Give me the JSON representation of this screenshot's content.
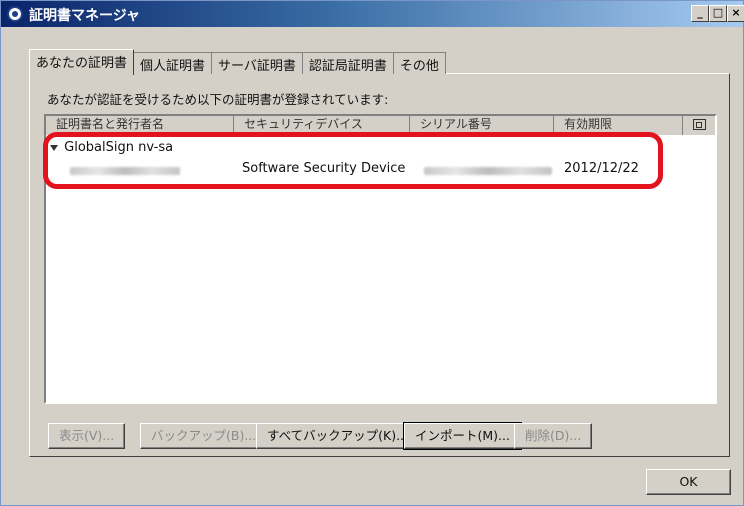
{
  "window": {
    "title": "証明書マネージャ",
    "controls": {
      "minimize": "_",
      "maximize": "□",
      "close": "×"
    }
  },
  "tabs": [
    {
      "label": "あなたの証明書"
    },
    {
      "label": "個人証明書"
    },
    {
      "label": "サーバ証明書"
    },
    {
      "label": "認証局証明書"
    },
    {
      "label": "その他"
    }
  ],
  "description": "あなたが認証を受けるため以下の証明書が登録されています:",
  "columns": [
    "証明書名と発行者名",
    "セキュリティデバイス",
    "シリアル番号",
    "有効期限"
  ],
  "tree": {
    "group": "GlobalSign nv-sa",
    "cert": {
      "device": "Software Security Device",
      "expires": "2012/12/22"
    }
  },
  "buttons": {
    "view": "表示(V)...",
    "backup": "バックアップ(B)...",
    "backup_all": "すべてバックアップ(K)...",
    "import": "インポート(M)...",
    "delete": "削除(D)...",
    "ok": "OK"
  },
  "colors": {
    "highlight": "#e4121d",
    "title_bar": "#0a246a"
  }
}
